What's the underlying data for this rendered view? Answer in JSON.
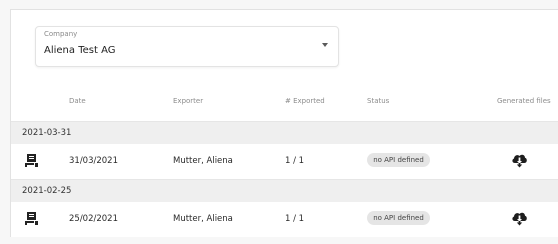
{
  "company": {
    "label": "Company",
    "value": "Aliena Test AG"
  },
  "columns": {
    "date": "Date",
    "exporter": "Exporter",
    "exported": "# Exported",
    "status": "Status",
    "generated_files": "Generated files"
  },
  "groups": [
    {
      "label": "2021-03-31",
      "rows": [
        {
          "date": "31/03/2021",
          "exporter": "Mutter, Aliena",
          "exported": "1 / 1",
          "status": "no API defined"
        }
      ]
    },
    {
      "label": "2021-02-25",
      "rows": [
        {
          "date": "25/02/2021",
          "exporter": "Mutter, Aliena",
          "exported": "1 / 1",
          "status": "no API defined"
        }
      ]
    }
  ],
  "icons": {
    "row_icon": "document-export-icon",
    "download_icon": "cloud-download-icon",
    "dropdown_icon": "chevron-down-icon"
  }
}
